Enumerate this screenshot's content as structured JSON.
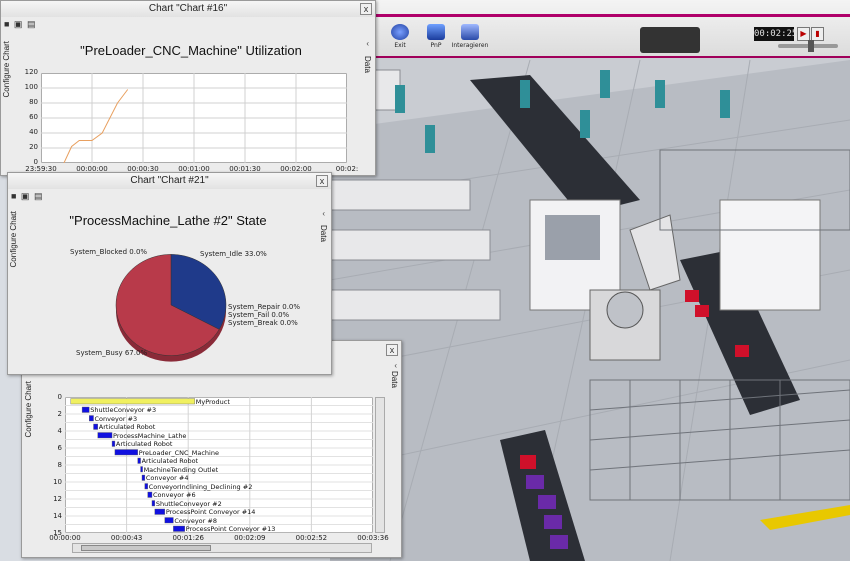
{
  "toolbar": {
    "buttons": [
      {
        "label": "Exit",
        "icon": "exit-icon"
      },
      {
        "label": "PnP",
        "icon": "pnp-icon"
      },
      {
        "label": "Interagieren",
        "icon": "interact-icon"
      }
    ],
    "clock": "00:02:25",
    "play_icon": "play-icon",
    "step_icon": "step-icon"
  },
  "win1": {
    "title": "Chart \"Chart #16\"",
    "close": "x",
    "mini_toolbar": "■ ▣ ▤",
    "left_tab": "Configure Chart",
    "right_tab": "Data",
    "chart_title": "\"PreLoader_CNC_Machine\" Utilization"
  },
  "win2": {
    "title": "Chart \"Chart #21\"",
    "close": "x",
    "mini_toolbar": "■ ▣ ▤",
    "left_tab": "Configure Chart",
    "right_tab": "Data",
    "chart_title": "\"ProcessMachine_Lathe #2\" State"
  },
  "win3": {
    "close": "x",
    "left_tab": "Configure Chart",
    "right_tab": "Data"
  },
  "chart_data": [
    {
      "type": "line",
      "title": "\"PreLoader_CNC_Machine\" Utilization",
      "x": [
        "23:59:30",
        "00:00:00",
        "00:00:30",
        "00:01:00",
        "00:01:30",
        "00:02:00",
        "00:02:"
      ],
      "ylim": [
        0,
        120
      ],
      "yticks": [
        "0",
        "20",
        "40",
        "60",
        "80",
        "100",
        "120"
      ],
      "series": [
        {
          "points": [
            [
              0.45,
              0
            ],
            [
              0.6,
              22
            ],
            [
              0.75,
              30
            ],
            [
              1.0,
              30
            ],
            [
              1.2,
              40
            ],
            [
              1.35,
              60
            ],
            [
              1.5,
              80
            ],
            [
              1.7,
              98
            ]
          ]
        }
      ],
      "grid": true
    },
    {
      "type": "pie",
      "title": "\"ProcessMachine_Lathe #2\" State",
      "slices": [
        {
          "label": "System_Blocked 0.0%",
          "value": 0.0,
          "color": "#c0c0c0"
        },
        {
          "label": "System_Idle 33.0%",
          "value": 33.0,
          "color": "#1f3a8a"
        },
        {
          "label": "System_Repair 0.0%",
          "value": 0.0,
          "color": "#888888"
        },
        {
          "label": "System_Fail 0.0%",
          "value": 0.0,
          "color": "#888888"
        },
        {
          "label": "System_Break 0.0%",
          "value": 0.0,
          "color": "#888888"
        },
        {
          "label": "System_Busy 67.0%",
          "value": 67.0,
          "color": "#b83a4a"
        }
      ]
    },
    {
      "type": "gantt",
      "x": [
        "00:00:00",
        "00:00:43",
        "00:01:26",
        "00:02:09",
        "00:02:52",
        "00:03:36"
      ],
      "y": [
        "0",
        "2",
        "4",
        "6",
        "8",
        "10",
        "12",
        "14",
        "15"
      ],
      "xlim": [
        0,
        216
      ],
      "rows": [
        {
          "label": "MyProduct",
          "start": 4,
          "end": 91,
          "color": "#f0f060"
        },
        {
          "label": "ShuttleConveyor #3",
          "start": 12,
          "end": 17,
          "color": "#1010e0"
        },
        {
          "label": "Conveyor #3",
          "start": 17,
          "end": 20,
          "color": "#1010e0"
        },
        {
          "label": "Articulated Robot",
          "start": 20,
          "end": 23,
          "color": "#1010e0"
        },
        {
          "label": "ProcessMachine_Lathe",
          "start": 23,
          "end": 33,
          "color": "#1010e0"
        },
        {
          "label": "Articulated Robot",
          "start": 33,
          "end": 35,
          "color": "#1010e0"
        },
        {
          "label": "PreLoader_CNC_Machine",
          "start": 35,
          "end": 51,
          "color": "#1010e0"
        },
        {
          "label": "Articulated Robot",
          "start": 51,
          "end": 53,
          "color": "#1010e0"
        },
        {
          "label": "MachineTending Outlet",
          "start": 53,
          "end": 54,
          "color": "#1010e0"
        },
        {
          "label": "Conveyor #4",
          "start": 54,
          "end": 56,
          "color": "#1010e0"
        },
        {
          "label": "ConveyorInclining_Declining #2",
          "start": 56,
          "end": 58,
          "color": "#1010e0"
        },
        {
          "label": "Conveyor #6",
          "start": 58,
          "end": 61,
          "color": "#1010e0"
        },
        {
          "label": "ShuttleConveyor #2",
          "start": 61,
          "end": 63,
          "color": "#1010e0"
        },
        {
          "label": "ProcessPoint Conveyor #14",
          "start": 63,
          "end": 70,
          "color": "#1010e0"
        },
        {
          "label": "Conveyor #8",
          "start": 70,
          "end": 76,
          "color": "#1010e0"
        },
        {
          "label": "ProcessPoint Conveyor #13",
          "start": 76,
          "end": 84,
          "color": "#1010e0"
        }
      ]
    }
  ]
}
